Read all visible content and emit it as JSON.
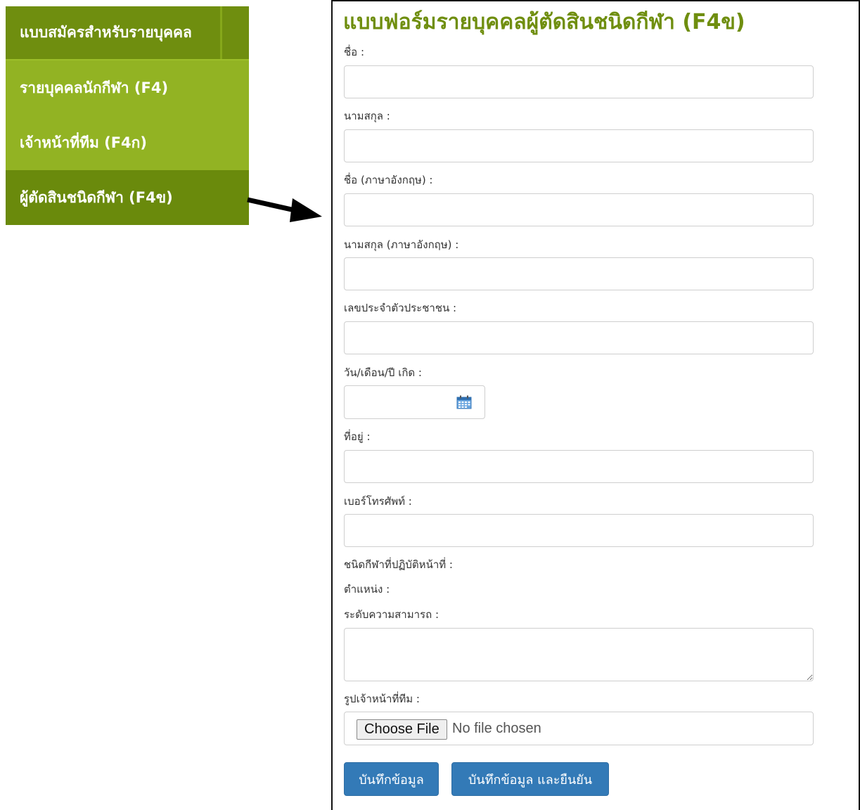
{
  "sidebar": {
    "header": "แบบสมัครสำหรับรายบุคคล",
    "items": [
      {
        "label": "รายบุคคลนักกีฬา (F4)"
      },
      {
        "label": "เจ้าหน้าที่ทีม (F4ก)"
      },
      {
        "label": "ผู้ตัดสินชนิดกีฬา (F4ข)"
      }
    ],
    "active_item": "ผู้ตัดสินชนิดกีฬา (F4ข)"
  },
  "form": {
    "title": "แบบฟอร์มรายบุคคลผู้ตัดสินชนิดกีฬา (F4ข)",
    "labels": {
      "first_name": "ชื่อ :",
      "last_name": "นามสกุล :",
      "first_name_en": "ชื่อ (ภาษาอังกฤษ) :",
      "last_name_en": "นามสกุล (ภาษาอังกฤษ) :",
      "citizen_id": "เลขประจำตัวประชาชน :",
      "birth_date": "วัน/เดือน/ปี เกิด :",
      "address": "ที่อยู่ :",
      "phone": "เบอร์โทรศัพท์ :",
      "sport_type": "ชนิดกีฬาที่ปฏิบัติหน้าที่ :",
      "position": "ตำแหน่ง :",
      "ability_level": "ระดับความสามารถ :",
      "staff_photo": "รูปเจ้าหน้าที่ทีม :"
    },
    "file": {
      "button_label": "Choose File",
      "status": "No file chosen"
    },
    "buttons": {
      "save": "บันทึกข้อมูล",
      "save_confirm": "บันทึกข้อมูล และยืนยัน"
    }
  },
  "colors": {
    "menu_green": "#8fb021",
    "menu_dark_green": "#6a8a0c",
    "title_green": "#6f8e0f",
    "button_blue": "#337ab7"
  },
  "icons": {
    "calendar": "calendar-icon",
    "pointer": "arrow-right-icon"
  }
}
